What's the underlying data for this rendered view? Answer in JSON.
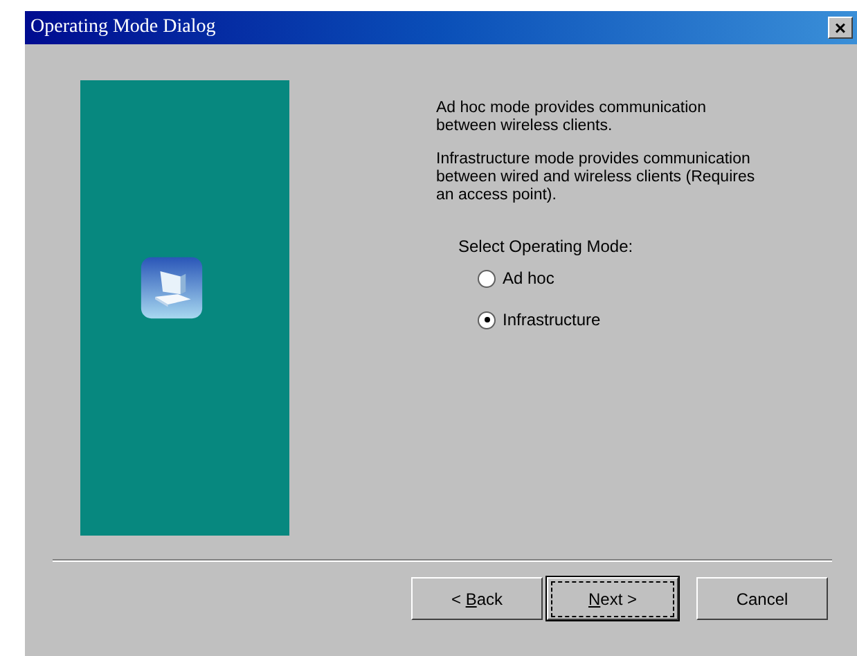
{
  "window": {
    "title": "Operating Mode Dialog",
    "close": "×"
  },
  "descriptions": [
    "Ad hoc mode provides communication between wireless clients.",
    "Infrastructure mode provides communication between wired and wireless clients (Requires an access point)."
  ],
  "mode_group": {
    "label": "Select Operating Mode:",
    "options": [
      {
        "label": "Ad hoc",
        "selected": false
      },
      {
        "label": "Infrastructure",
        "selected": true
      }
    ]
  },
  "buttons": [
    {
      "label": "ack",
      "prefix": "< ",
      "mnemonic": "B",
      "focused": false
    },
    {
      "label": "ext >",
      "mnemonic": "N",
      "focused": true
    },
    {
      "label": "Cancel",
      "focused": false
    }
  ]
}
